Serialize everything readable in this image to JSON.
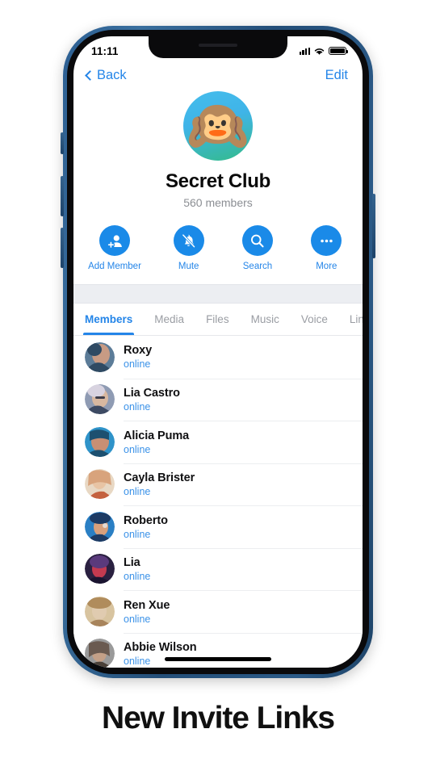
{
  "caption": "New Invite Links",
  "status_bar": {
    "time": "11:11",
    "signal_icon": "cellular-signal-icon",
    "wifi_icon": "wifi-icon",
    "battery_icon": "battery-full-icon"
  },
  "nav": {
    "back_label": "Back",
    "edit_label": "Edit",
    "back_icon": "chevron-left-icon"
  },
  "profile": {
    "avatar_emoji": "🙉",
    "avatar_icon": "hear-no-evil-monkey-avatar",
    "title": "Secret Club",
    "subtitle": "560 members"
  },
  "actions": [
    {
      "label": "Add Member",
      "icon": "add-member-icon"
    },
    {
      "label": "Mute",
      "icon": "bell-slash-icon"
    },
    {
      "label": "Search",
      "icon": "search-icon"
    },
    {
      "label": "More",
      "icon": "ellipsis-icon"
    }
  ],
  "tabs": [
    {
      "label": "Members",
      "active": true
    },
    {
      "label": "Media",
      "active": false
    },
    {
      "label": "Files",
      "active": false
    },
    {
      "label": "Music",
      "active": false
    },
    {
      "label": "Voice",
      "active": false
    },
    {
      "label": "Lin",
      "active": false
    }
  ],
  "members": [
    {
      "name": "Roxy",
      "status": "online",
      "avatar_colors": [
        "#5c7c98",
        "#c89b84",
        "#2f4a63"
      ]
    },
    {
      "name": "Lia Castro",
      "status": "online",
      "avatar_colors": [
        "#8f9bb3",
        "#d8d3e0",
        "#3d4a63"
      ]
    },
    {
      "name": "Alicia Puma",
      "status": "online",
      "avatar_colors": [
        "#2f93c9",
        "#c98f74",
        "#1d5070"
      ]
    },
    {
      "name": "Cayla Brister",
      "status": "online",
      "avatar_colors": [
        "#e8d8c4",
        "#d8a37c",
        "#c4613f"
      ]
    },
    {
      "name": "Roberto",
      "status": "online",
      "avatar_colors": [
        "#2a7fc4",
        "#1d3a63",
        "#d8a07c"
      ]
    },
    {
      "name": "Lia",
      "status": "online",
      "avatar_colors": [
        "#2a2040",
        "#c43a50",
        "#5a3a7c"
      ]
    },
    {
      "name": "Ren Xue",
      "status": "online",
      "avatar_colors": [
        "#d8c4a0",
        "#b08c5c",
        "#e0cbb0"
      ]
    },
    {
      "name": "Abbie Wilson",
      "status": "online",
      "avatar_colors": [
        "#9a9a9a",
        "#c4a087",
        "#6a5a50"
      ]
    }
  ],
  "colors": {
    "accent_blue": "#2485e8",
    "action_blue": "#1a8ae8",
    "frame_navy": "#2d5f92",
    "gray_band": "#eceef2"
  }
}
